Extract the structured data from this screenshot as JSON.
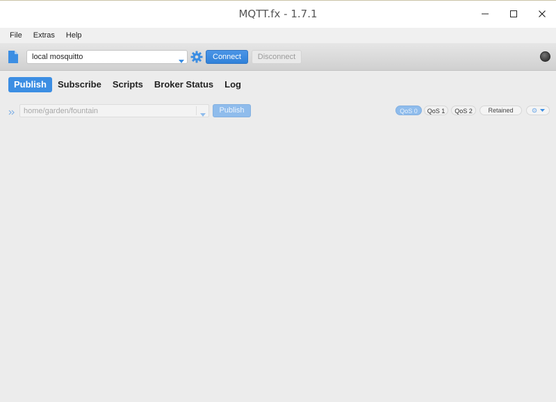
{
  "window": {
    "title": "MQTT.fx - 1.7.1"
  },
  "menu": {
    "items": [
      "File",
      "Extras",
      "Help"
    ]
  },
  "toolbar": {
    "profile_value": "local mosquitto",
    "connect_label": "Connect",
    "disconnect_label": "Disconnect"
  },
  "tabs": [
    "Publish",
    "Subscribe",
    "Scripts",
    "Broker Status",
    "Log"
  ],
  "publish": {
    "topic_placeholder": "home/garden/fountain",
    "publish_label": "Publish",
    "qos": [
      "QoS 0",
      "QoS 1",
      "QoS 2"
    ],
    "retained_label": "Retained"
  },
  "colors": {
    "accent": "#3c8ee3",
    "connect_button": "#3081d9"
  },
  "icons": {
    "profile": "document-icon",
    "settings": "gear-icon",
    "status": "connection-status-led",
    "expand": "double-chevron-right-icon"
  }
}
